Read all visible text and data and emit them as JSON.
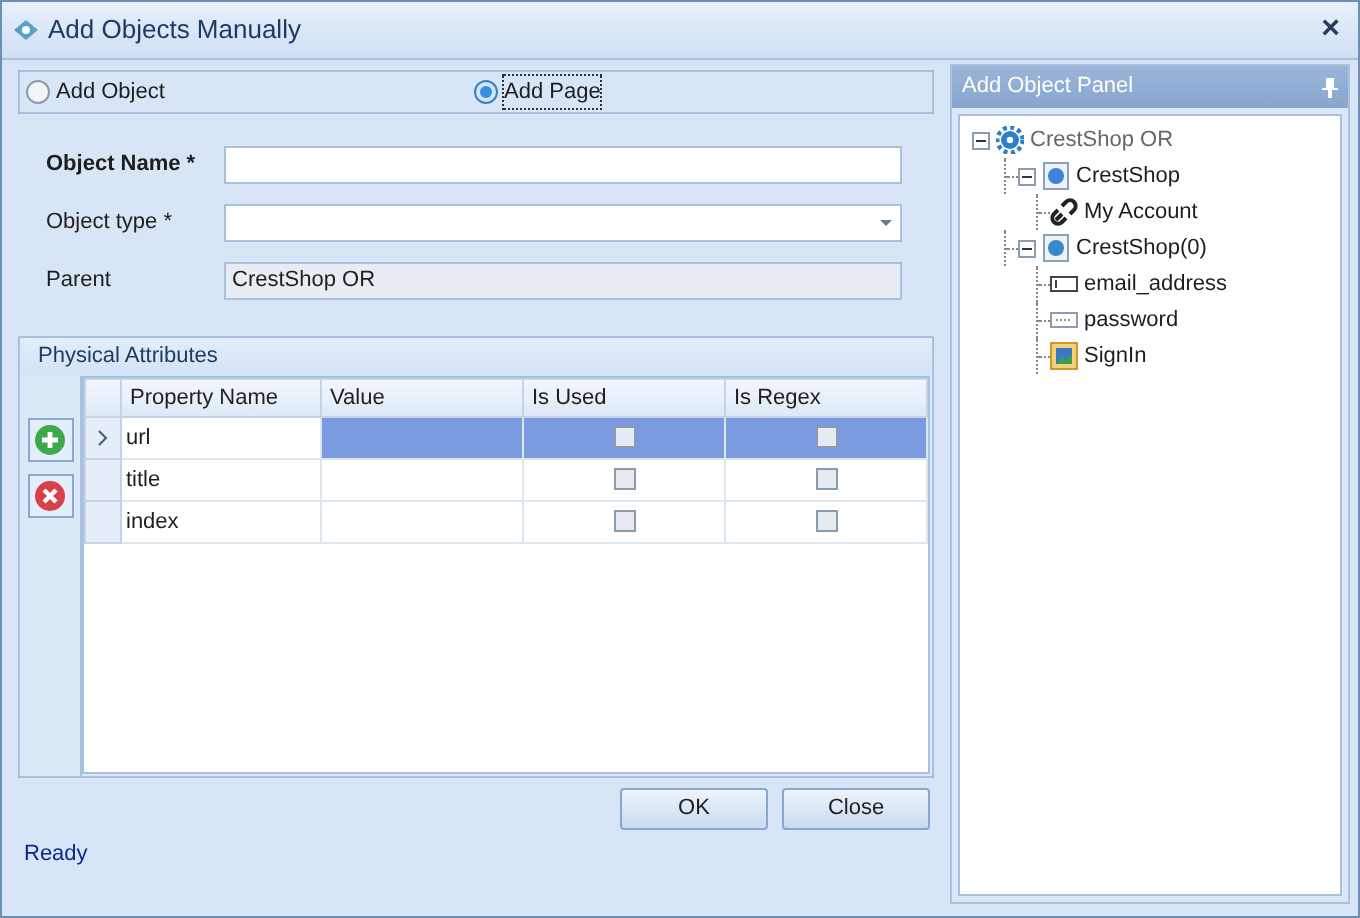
{
  "window": {
    "title": "Add Objects Manually",
    "close": "×"
  },
  "mode_options": [
    {
      "label": "Add Object",
      "selected": false
    },
    {
      "label": "Add Page",
      "selected": true
    }
  ],
  "fields": [
    {
      "label": "Object Name *",
      "bold": true,
      "kind": "text"
    },
    {
      "label": "Object type *",
      "bold": false,
      "kind": "dropdown"
    },
    {
      "label": "Parent",
      "bold": false,
      "kind": "readonly",
      "value": "CrestShop OR"
    }
  ],
  "attributes": {
    "title": "Physical Attributes",
    "columns": [
      "Property Name",
      "Value",
      "Is Used",
      "Is Regex"
    ],
    "rows": [
      {
        "property": "url",
        "selected": true,
        "is_used": false,
        "is_regex": false
      },
      {
        "property": "title",
        "selected": false,
        "is_used": false,
        "is_regex": false
      },
      {
        "property": "index",
        "selected": false,
        "is_used": false,
        "is_regex": false
      }
    ]
  },
  "buttons": [
    "OK",
    "Close"
  ],
  "status": "Ready",
  "panel": {
    "title": "Add Object Panel",
    "tree": [
      {
        "label": "CrestShop OR",
        "kind": "repository",
        "expanded": true,
        "children": [
          {
            "label": "CrestShop",
            "kind": "page",
            "expanded": true,
            "children": [
              {
                "label": "My Account",
                "kind": "link"
              }
            ]
          },
          {
            "label": "CrestShop(0)",
            "kind": "page",
            "expanded": true,
            "children": [
              {
                "label": "email_address",
                "kind": "textbox"
              },
              {
                "label": "password",
                "kind": "password"
              },
              {
                "label": "SignIn",
                "kind": "image"
              }
            ]
          }
        ]
      }
    ]
  }
}
